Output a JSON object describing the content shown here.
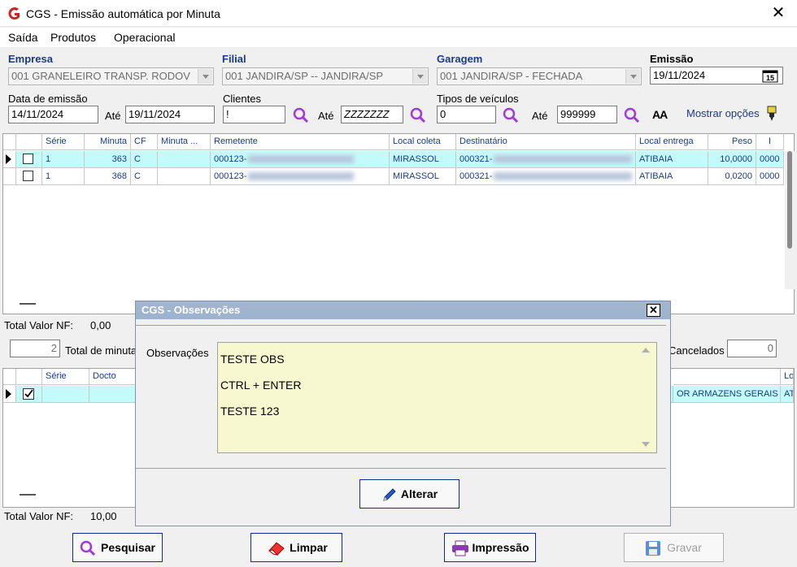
{
  "window": {
    "title": "CGS - Emissão automática por Minuta",
    "close_glyph": "✕"
  },
  "menu": [
    "Saída",
    "Produtos",
    "Operacional"
  ],
  "filters": {
    "empresa_label": "Empresa",
    "empresa_value": "001 GRANELEIRO TRANSP. RODOV",
    "filial_label": "Filial",
    "filial_value": "001 JANDIRA/SP -- JANDIRA/SP",
    "garagem_label": "Garagem",
    "garagem_value": "001 JANDIRA/SP - FECHADA",
    "emissao_label": "Emissão",
    "emissao_value": "19/11/2024",
    "data_emissao_label": "Data de emissão",
    "data_de": "14/11/2024",
    "ate_label": "Até",
    "data_ate": "19/11/2024",
    "clientes_label": "Clientes",
    "clientes_de": "!",
    "clientes_ate": "ZZZZZZZ",
    "tipos_label": "Tipos de veículos",
    "tipos_de": "0",
    "tipos_ate": "999999",
    "mostrar_opcoes": "Mostrar opções",
    "font_icon_text": "AA"
  },
  "grid1": {
    "headers": [
      "Série",
      "Minuta",
      "CF",
      "Minuta ...",
      "Remetente",
      "Local coleta",
      "Destinatário",
      "Local entrega",
      "Peso",
      "I"
    ],
    "rows": [
      {
        "serie": "1",
        "minuta": "363",
        "cf": "C",
        "minuta2": "",
        "remetente": "000123-",
        "local_coleta": "MIRASSOL",
        "destinatario": "000321-",
        "local_entrega": "ATIBAIA",
        "peso": "10,0000",
        "extra": "0000"
      },
      {
        "serie": "1",
        "minuta": "368",
        "cf": "C",
        "minuta2": "",
        "remetente": "000123-",
        "local_coleta": "MIRASSOL",
        "destinatario": "000321-",
        "local_entrega": "ATIBAIA",
        "peso": "0,0200",
        "extra": "0000"
      }
    ],
    "total_label": "Total Valor NF:",
    "total_value": "0,00"
  },
  "summary": {
    "count": "2",
    "total_minutas_label": "Total de minuta",
    "cancelados_label": "Cancelados",
    "cancelados_value": "0"
  },
  "grid2": {
    "headers": [
      "Série",
      "Docto",
      "Lo"
    ],
    "row_tail": "OR ARMAZENS GERAIS",
    "row_tail2": "ATI",
    "total_label": "Total Valor NF:",
    "total_value": "10,00"
  },
  "dialog": {
    "title": "CGS - Observações",
    "close_glyph": "✕",
    "obs_label": "Observações",
    "obs_lines": [
      "TESTE OBS",
      "CTRL + ENTER",
      "TESTE 123"
    ],
    "alterar_label": "Alterar"
  },
  "buttons": {
    "pesquisar": "Pesquisar",
    "limpar": "Limpar",
    "impressao": "Impressão",
    "gravar": "Gravar"
  },
  "colors": {
    "accent": "#1a3a8a",
    "selected_row": "#c3fbfb",
    "obs_bg": "#f7f7d0",
    "dialog_title": "#9cb2cd"
  }
}
